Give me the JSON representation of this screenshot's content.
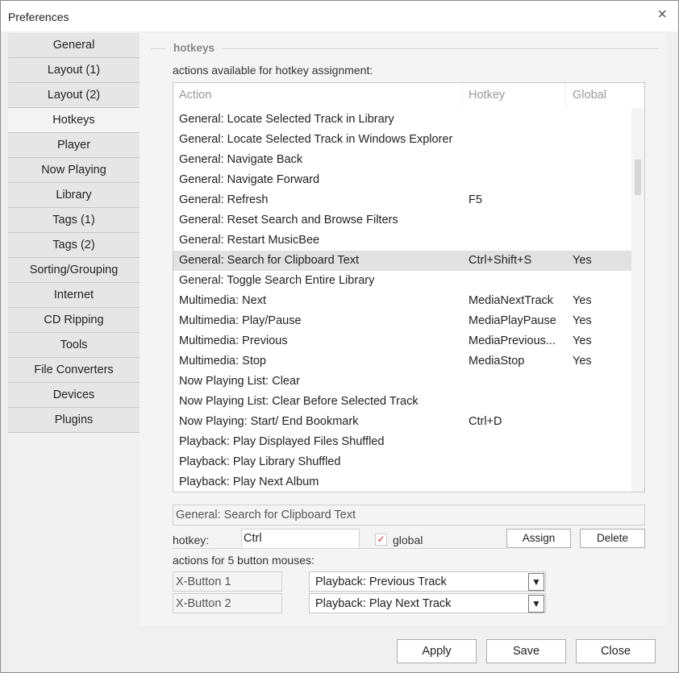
{
  "window": {
    "title": "Preferences",
    "close_icon": "×"
  },
  "sidebar": {
    "items": [
      {
        "label": "General"
      },
      {
        "label": "Layout (1)"
      },
      {
        "label": "Layout (2)"
      },
      {
        "label": "Hotkeys",
        "selected": true
      },
      {
        "label": "Player"
      },
      {
        "label": "Now Playing"
      },
      {
        "label": "Library"
      },
      {
        "label": "Tags (1)"
      },
      {
        "label": "Tags (2)"
      },
      {
        "label": "Sorting/Grouping"
      },
      {
        "label": "Internet"
      },
      {
        "label": "CD Ripping"
      },
      {
        "label": "Tools"
      },
      {
        "label": "File Converters"
      },
      {
        "label": "Devices"
      },
      {
        "label": "Plugins"
      }
    ]
  },
  "panel": {
    "section_title": "hotkeys",
    "list_label": "actions available for hotkey assignment:",
    "columns": {
      "action": "Action",
      "hotkey": "Hotkey",
      "global": "Global"
    },
    "rows": [
      {
        "action": "General: Locate Selected Track in Library",
        "hotkey": "",
        "global": ""
      },
      {
        "action": "General: Locate Selected Track in Windows Explorer",
        "hotkey": "",
        "global": ""
      },
      {
        "action": "General: Navigate Back",
        "hotkey": "",
        "global": ""
      },
      {
        "action": "General: Navigate Forward",
        "hotkey": "",
        "global": ""
      },
      {
        "action": "General: Refresh",
        "hotkey": "F5",
        "global": ""
      },
      {
        "action": "General: Reset Search and Browse Filters",
        "hotkey": "",
        "global": ""
      },
      {
        "action": "General: Restart MusicBee",
        "hotkey": "",
        "global": ""
      },
      {
        "action": "General: Search for Clipboard Text",
        "hotkey": "Ctrl+Shift+S",
        "global": "Yes",
        "selected": true
      },
      {
        "action": "General: Toggle Search Entire Library",
        "hotkey": "",
        "global": ""
      },
      {
        "action": "Multimedia: Next",
        "hotkey": "MediaNextTrack",
        "global": "Yes"
      },
      {
        "action": "Multimedia: Play/Pause",
        "hotkey": "MediaPlayPause",
        "global": "Yes"
      },
      {
        "action": "Multimedia: Previous",
        "hotkey": "MediaPrevious...",
        "global": "Yes"
      },
      {
        "action": "Multimedia: Stop",
        "hotkey": "MediaStop",
        "global": "Yes"
      },
      {
        "action": "Now Playing List: Clear",
        "hotkey": "",
        "global": ""
      },
      {
        "action": "Now Playing List: Clear Before Selected Track",
        "hotkey": "",
        "global": ""
      },
      {
        "action": "Now Playing: Start/ End Bookmark",
        "hotkey": "Ctrl+D",
        "global": ""
      },
      {
        "action": "Playback: Play Displayed Files Shuffled",
        "hotkey": "",
        "global": ""
      },
      {
        "action": "Playback: Play Library Shuffled",
        "hotkey": "",
        "global": ""
      },
      {
        "action": "Playback: Play Next Album",
        "hotkey": "",
        "global": ""
      }
    ],
    "selected_action": "General: Search for Clipboard Text",
    "hotkey_label": "hotkey:",
    "hotkey_value": "Ctrl",
    "global_label": "global",
    "global_checked": true,
    "assign_label": "Assign",
    "delete_label": "Delete",
    "mouse_label": "actions for 5 button mouses:",
    "mouse_buttons": [
      {
        "label": "X-Button 1",
        "action": "Playback: Previous Track"
      },
      {
        "label": "X-Button 2",
        "action": "Playback: Play Next Track"
      }
    ]
  },
  "footer": {
    "apply": "Apply",
    "save": "Save",
    "close": "Close"
  }
}
